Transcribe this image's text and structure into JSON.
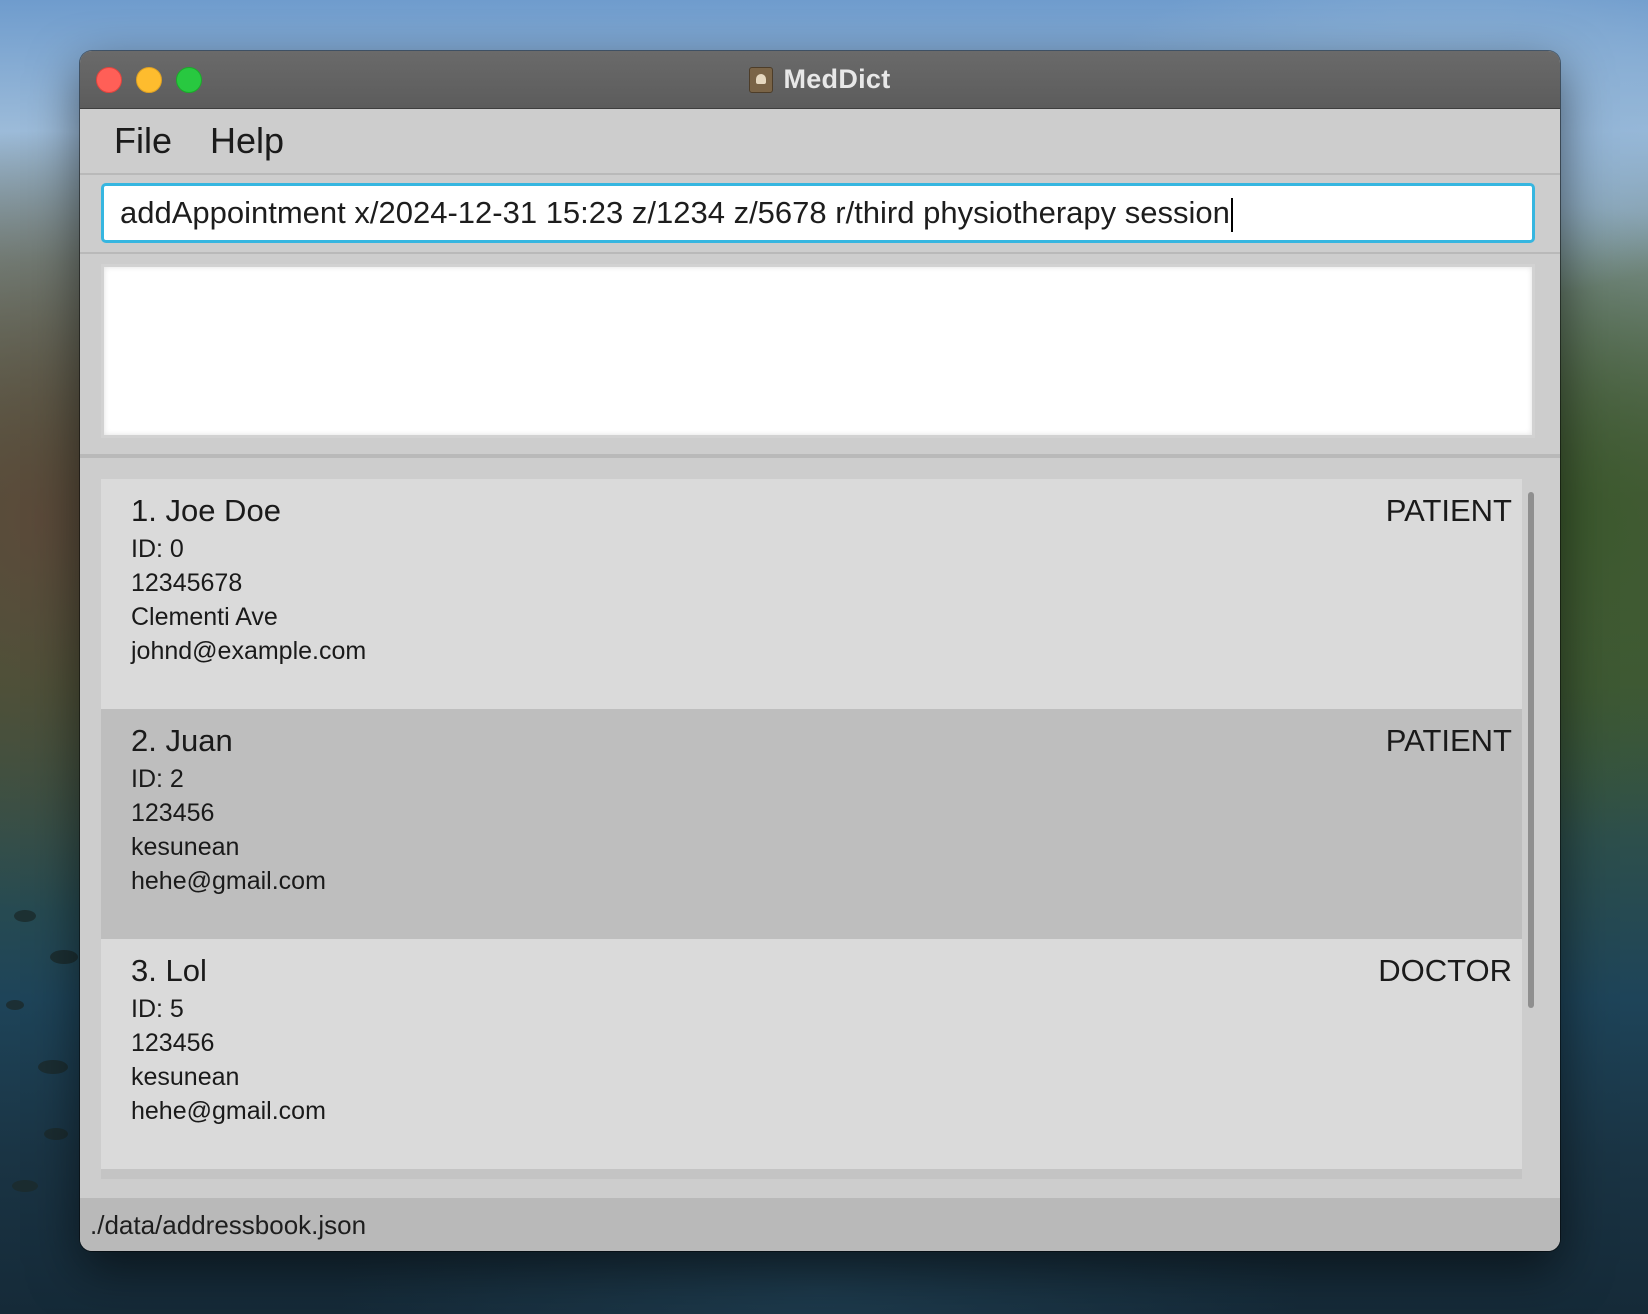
{
  "window": {
    "title": "MedDict"
  },
  "menu": {
    "file": "File",
    "help": "Help"
  },
  "command": {
    "value": "addAppointment x/2024-12-31 15:23 z/1234 z/5678 r/third physiotherapy session"
  },
  "result": {
    "text": ""
  },
  "persons": [
    {
      "name": "1. Joe Doe",
      "role": "PATIENT",
      "id": "ID: 0",
      "phone": "12345678",
      "address": "Clementi Ave",
      "email": "johnd@example.com"
    },
    {
      "name": "2. Juan",
      "role": "PATIENT",
      "id": "ID: 2",
      "phone": "123456",
      "address": "kesunean",
      "email": "hehe@gmail.com"
    },
    {
      "name": "3. Lol",
      "role": "DOCTOR",
      "id": "ID: 5",
      "phone": "123456",
      "address": "kesunean",
      "email": "hehe@gmail.com"
    }
  ],
  "status": {
    "file_path": "./data/addressbook.json"
  },
  "colors": {
    "accent_border": "#36b6e0",
    "close": "#ff5f57",
    "minimize": "#febc2e",
    "maximize": "#28c840"
  }
}
